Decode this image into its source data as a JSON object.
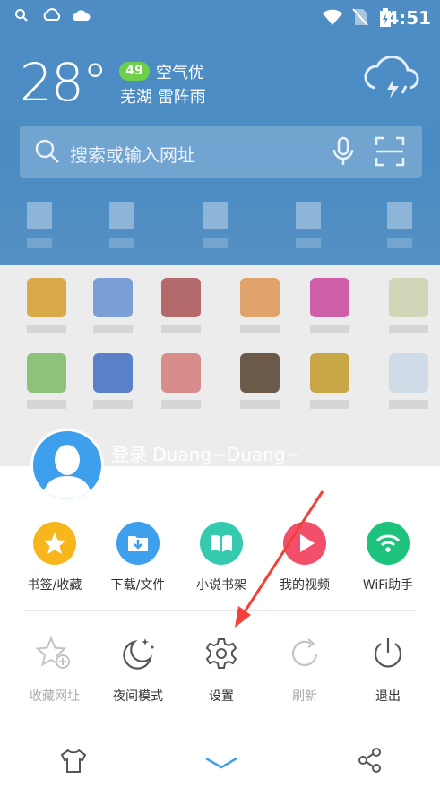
{
  "status_bar": {
    "time": "4:51"
  },
  "weather": {
    "temperature": "28°",
    "aqi_value": "49",
    "aqi_label": "空气优",
    "location_condition": "芜湖  雷阵雨"
  },
  "search": {
    "placeholder": "搜索或输入网址"
  },
  "account": {
    "login_label": "登录 Duang~Duang~"
  },
  "menu_row1": [
    {
      "label": "书签/收藏",
      "color": "#f6b61c",
      "icon": "star-icon"
    },
    {
      "label": "下载/文件",
      "color": "#3ea0ec",
      "icon": "download-folder-icon"
    },
    {
      "label": "小说书架",
      "color": "#35c9b0",
      "icon": "book-icon"
    },
    {
      "label": "我的视频",
      "color": "#f2506a",
      "icon": "play-icon"
    },
    {
      "label": "WiFi助手",
      "color": "#1dc37c",
      "icon": "wifi-icon"
    }
  ],
  "menu_row2": [
    {
      "label": "收藏网址",
      "icon": "star-add-icon",
      "enabled": false
    },
    {
      "label": "夜间模式",
      "icon": "moon-icon",
      "enabled": true
    },
    {
      "label": "设置",
      "icon": "gear-icon",
      "enabled": true
    },
    {
      "label": "刷新",
      "icon": "refresh-icon",
      "enabled": false
    },
    {
      "label": "退出",
      "icon": "power-icon",
      "enabled": true
    }
  ],
  "bottom_bar": {
    "items": [
      "shirt-icon",
      "chevron-down-icon",
      "share-icon"
    ]
  },
  "colors": {
    "annotation_arrow": "#f2403a",
    "header_blue": "#4a8bc3"
  }
}
